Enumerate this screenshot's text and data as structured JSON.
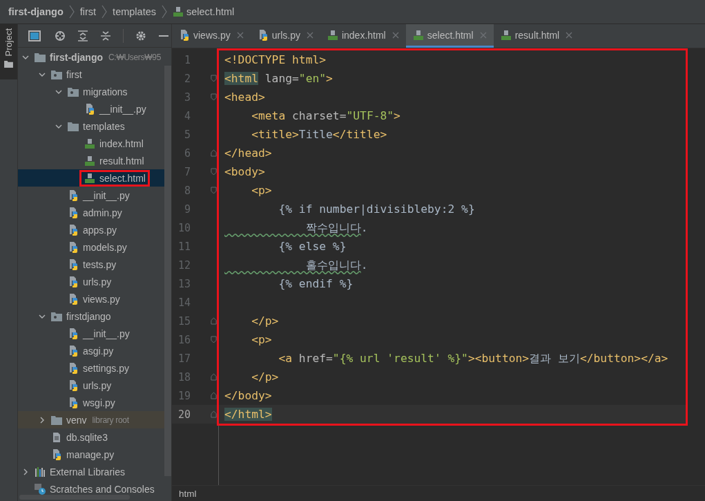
{
  "breadcrumbs": [
    {
      "label": "first-django",
      "kind": "folder"
    },
    {
      "label": "first",
      "kind": "folder"
    },
    {
      "label": "templates",
      "kind": "folder"
    },
    {
      "label": "select.html",
      "kind": "html"
    }
  ],
  "side_tab": {
    "label": "Project",
    "selected": true
  },
  "tree": [
    {
      "label": "first-django",
      "hint": "C:₩Users₩95",
      "kind": "folder",
      "expanded": true,
      "selected": false,
      "annotated": false,
      "children": [
        {
          "label": "first",
          "kind": "package",
          "expanded": true,
          "selected": false,
          "annotated": false,
          "children": [
            {
              "label": "migrations",
              "kind": "package",
              "expanded": true,
              "selected": false,
              "annotated": false,
              "children": [
                {
                  "label": "__init__.py",
                  "kind": "python",
                  "selected": false,
                  "annotated": false
                }
              ]
            },
            {
              "label": "templates",
              "kind": "folder",
              "expanded": true,
              "selected": false,
              "annotated": false,
              "children": [
                {
                  "label": "index.html",
                  "kind": "html",
                  "selected": false,
                  "annotated": false
                },
                {
                  "label": "result.html",
                  "kind": "html",
                  "selected": false,
                  "annotated": false
                },
                {
                  "label": "select.html",
                  "kind": "html",
                  "selected": true,
                  "annotated": true
                }
              ]
            },
            {
              "label": "__init__.py",
              "kind": "python",
              "selected": false,
              "annotated": false
            },
            {
              "label": "admin.py",
              "kind": "python",
              "selected": false,
              "annotated": false
            },
            {
              "label": "apps.py",
              "kind": "python",
              "selected": false,
              "annotated": false
            },
            {
              "label": "models.py",
              "kind": "python",
              "selected": false,
              "annotated": false
            },
            {
              "label": "tests.py",
              "kind": "python",
              "selected": false,
              "annotated": false
            },
            {
              "label": "urls.py",
              "kind": "python",
              "selected": false,
              "annotated": false
            },
            {
              "label": "views.py",
              "kind": "python",
              "selected": false,
              "annotated": false
            }
          ]
        },
        {
          "label": "firstdjango",
          "kind": "package",
          "expanded": true,
          "selected": false,
          "annotated": false,
          "children": [
            {
              "label": "__init__.py",
              "kind": "python",
              "selected": false,
              "annotated": false
            },
            {
              "label": "asgi.py",
              "kind": "python",
              "selected": false,
              "annotated": false
            },
            {
              "label": "settings.py",
              "kind": "python",
              "selected": false,
              "annotated": false
            },
            {
              "label": "urls.py",
              "kind": "python",
              "selected": false,
              "annotated": false
            },
            {
              "label": "wsgi.py",
              "kind": "python",
              "selected": false,
              "annotated": false
            }
          ]
        },
        {
          "label": "venv",
          "hint": "library root",
          "kind": "folder",
          "expanded": false,
          "library_root": true,
          "selected": false,
          "annotated": false
        },
        {
          "label": "db.sqlite3",
          "kind": "text",
          "selected": false,
          "annotated": false
        },
        {
          "label": "manage.py",
          "kind": "python",
          "selected": false,
          "annotated": false
        }
      ]
    },
    {
      "label": "External Libraries",
      "kind": "libraries",
      "expanded": false,
      "selected": false,
      "annotated": false
    },
    {
      "label": "Scratches and Consoles",
      "kind": "scratches",
      "selected": false,
      "annotated": false
    }
  ],
  "tabs": [
    {
      "label": "views.py",
      "kind": "python",
      "selected": false
    },
    {
      "label": "urls.py",
      "kind": "python",
      "selected": false
    },
    {
      "label": "index.html",
      "kind": "html",
      "selected": false
    },
    {
      "label": "select.html",
      "kind": "html",
      "selected": true
    },
    {
      "label": "result.html",
      "kind": "html",
      "selected": false
    }
  ],
  "editor": {
    "annotated": true,
    "lines": [
      {
        "number": "1",
        "current": false,
        "kind": "plain",
        "tokens": [
          {
            "kind": "tag",
            "text": "<!DOCTYPE html>"
          }
        ]
      },
      {
        "number": "2",
        "current": false,
        "kind": "fold-start",
        "tokens": [
          {
            "kind": "match",
            "text": "<html"
          },
          {
            "kind": "attr",
            "text": " lang="
          },
          {
            "kind": "string",
            "text": "\"en\""
          },
          {
            "kind": "tag",
            "text": ">"
          }
        ]
      },
      {
        "number": "3",
        "current": false,
        "kind": "fold-start",
        "tokens": [
          {
            "kind": "tag",
            "text": "<head>"
          }
        ]
      },
      {
        "number": "4",
        "current": false,
        "kind": "plain",
        "tokens": [
          {
            "kind": "tag",
            "text": "    <meta"
          },
          {
            "kind": "attr",
            "text": " charset="
          },
          {
            "kind": "string",
            "text": "\"UTF-8\""
          },
          {
            "kind": "tag",
            "text": ">"
          }
        ]
      },
      {
        "number": "5",
        "current": false,
        "kind": "plain",
        "tokens": [
          {
            "kind": "tag",
            "text": "    <title>"
          },
          {
            "kind": "text",
            "text": "Title"
          },
          {
            "kind": "tag",
            "text": "</title>"
          }
        ]
      },
      {
        "number": "6",
        "current": false,
        "kind": "fold-end",
        "tokens": [
          {
            "kind": "tag",
            "text": "</head>"
          }
        ]
      },
      {
        "number": "7",
        "current": false,
        "kind": "fold-start",
        "tokens": [
          {
            "kind": "tag",
            "text": "<body>"
          }
        ]
      },
      {
        "number": "8",
        "current": false,
        "kind": "fold-start",
        "tokens": [
          {
            "kind": "tag",
            "text": "    <p>"
          }
        ]
      },
      {
        "number": "9",
        "current": false,
        "kind": "plain",
        "tokens": [
          {
            "kind": "text",
            "text": "        {% if number|divisibleby:2 %}"
          }
        ]
      },
      {
        "number": "10",
        "current": false,
        "kind": "plain",
        "tokens": [
          {
            "kind": "typo",
            "text": "            짝수입니다"
          },
          {
            "kind": "text",
            "text": "."
          }
        ]
      },
      {
        "number": "11",
        "current": false,
        "kind": "plain",
        "tokens": [
          {
            "kind": "text",
            "text": "        {% else %}"
          }
        ]
      },
      {
        "number": "12",
        "current": false,
        "kind": "plain",
        "tokens": [
          {
            "kind": "typo",
            "text": "            홀수입니다"
          },
          {
            "kind": "text",
            "text": "."
          }
        ]
      },
      {
        "number": "13",
        "current": false,
        "kind": "plain",
        "tokens": [
          {
            "kind": "text",
            "text": "        {% endif %}"
          }
        ]
      },
      {
        "number": "14",
        "current": false,
        "kind": "plain"
      },
      {
        "number": "15",
        "current": false,
        "kind": "fold-end",
        "tokens": [
          {
            "kind": "tag",
            "text": "    </p>"
          }
        ]
      },
      {
        "number": "16",
        "current": false,
        "kind": "fold-start",
        "tokens": [
          {
            "kind": "tag",
            "text": "    <p>"
          }
        ]
      },
      {
        "number": "17",
        "current": false,
        "kind": "plain",
        "tokens": [
          {
            "kind": "tag",
            "text": "        <a"
          },
          {
            "kind": "attr",
            "text": " href="
          },
          {
            "kind": "string",
            "text": "\"{% url 'result' %}\""
          },
          {
            "kind": "tag",
            "text": "><button>"
          },
          {
            "kind": "text",
            "text": "결과 보기"
          },
          {
            "kind": "tag",
            "text": "</button></a>"
          }
        ]
      },
      {
        "number": "18",
        "current": false,
        "kind": "fold-end",
        "tokens": [
          {
            "kind": "tag",
            "text": "    </p>"
          }
        ]
      },
      {
        "number": "19",
        "current": false,
        "kind": "fold-end",
        "tokens": [
          {
            "kind": "tag",
            "text": "</body>"
          }
        ]
      },
      {
        "number": "20",
        "current": true,
        "kind": "fold-end",
        "tokens": [
          {
            "kind": "match",
            "text": "</html>"
          }
        ]
      }
    ]
  },
  "status_bar": {
    "path": "html"
  }
}
